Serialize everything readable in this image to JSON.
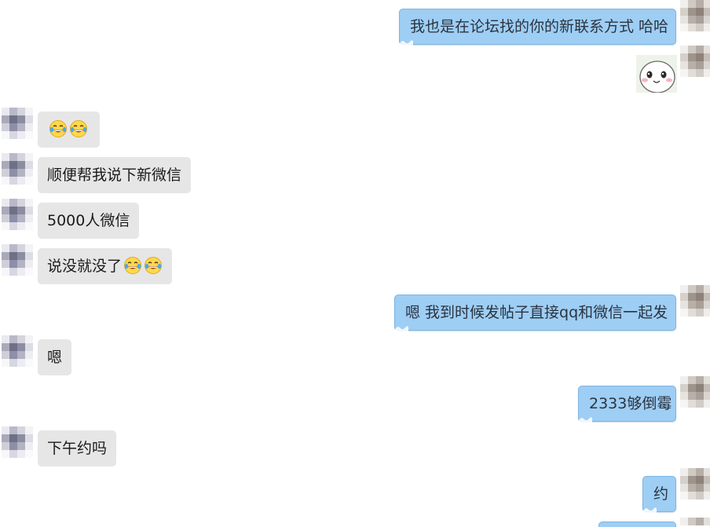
{
  "messages": [
    {
      "side": "right",
      "text": "我也是在论坛找的你的新联系方式 哈哈"
    },
    {
      "side": "right",
      "type": "sticker",
      "sticker": "smiling-blob-sticker"
    },
    {
      "side": "left",
      "text": "",
      "emojis": [
        "face-with-tears-of-joy",
        "face-with-tears-of-joy"
      ]
    },
    {
      "side": "left",
      "text": "顺便帮我说下新微信"
    },
    {
      "side": "left",
      "text": "5000人微信"
    },
    {
      "side": "left",
      "text": "说没就没了",
      "emojis": [
        "face-with-tears-of-joy",
        "face-with-tears-of-joy"
      ]
    },
    {
      "side": "right",
      "text": "嗯 我到时候发帖子直接qq和微信一起发"
    },
    {
      "side": "left",
      "text": "嗯"
    },
    {
      "side": "right",
      "text": "2333够倒霉"
    },
    {
      "side": "left",
      "text": "下午约吗"
    },
    {
      "side": "right",
      "text": "约"
    }
  ],
  "colors": {
    "sent_bubble": "#9ecef4",
    "sent_border": "#7db4e2",
    "received_bubble": "#e6e6e6",
    "background": "#ffffff"
  }
}
